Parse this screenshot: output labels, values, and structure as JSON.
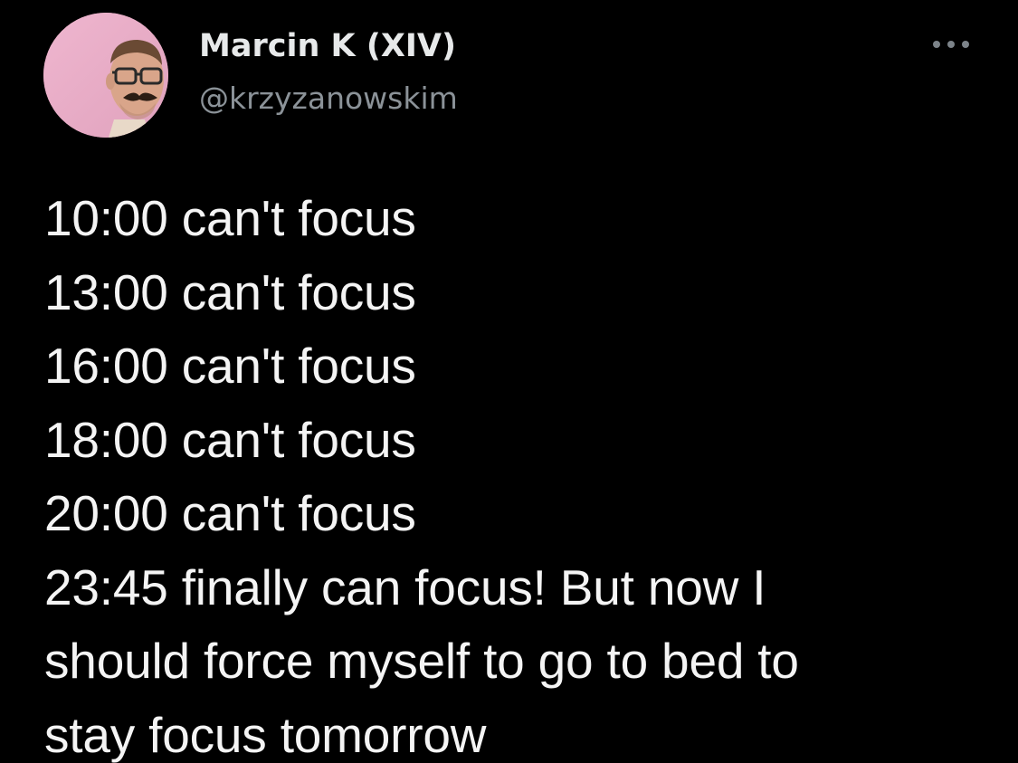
{
  "author": {
    "display_name": "Marcin K (XIV)",
    "handle": "@krzyzanowskim",
    "avatar_icon": "profile-photo-avatar"
  },
  "menu": {
    "more_icon": "more-options-icon"
  },
  "tweet": {
    "lines": [
      "10:00 can't focus",
      "13:00 can't focus",
      "16:00 can't focus",
      "18:00 can't focus",
      "20:00 can't focus",
      "23:45 finally can focus! But now I",
      "should force myself to go to bed to",
      "stay focus tomorrow"
    ]
  },
  "colors": {
    "background": "#000000",
    "name": "#e7e9ea",
    "handle": "#8b9298",
    "text": "#f4f4f4",
    "avatar_bg": "#e9aec8"
  }
}
